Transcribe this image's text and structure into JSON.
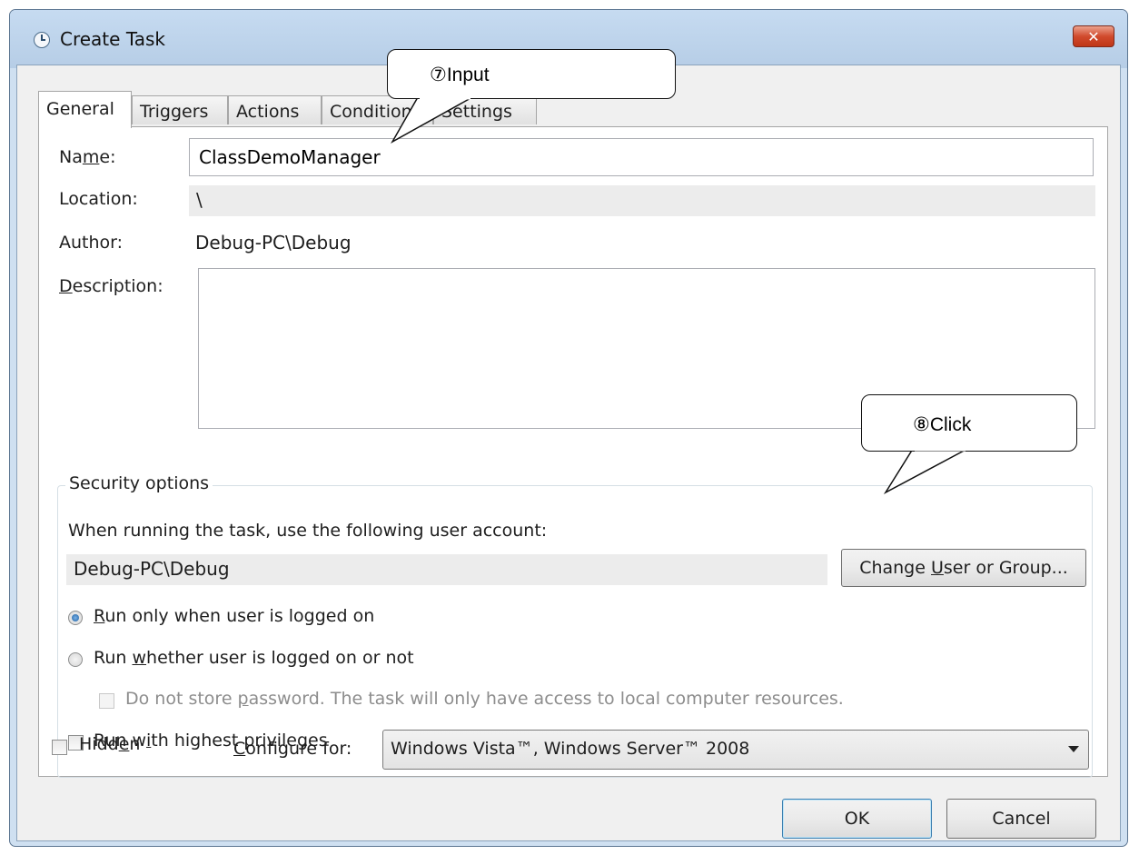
{
  "window": {
    "title": "Create Task",
    "close_glyph": "✕"
  },
  "tabs": [
    "General",
    "Triggers",
    "Actions",
    "Conditions",
    "Settings"
  ],
  "general": {
    "name_label_pre": "Na",
    "name_label_ul": "m",
    "name_label_post": "e:",
    "name_value": "ClassDemoManager",
    "location_label": "Location:",
    "location_value": "\\",
    "author_label": "Author:",
    "author_value": "Debug-PC\\Debug",
    "description_label_ul": "D",
    "description_label_post": "escription:",
    "description_value": ""
  },
  "security": {
    "group_title": "Security options",
    "account_prompt": "When running the task, use the following user account:",
    "account_value": "Debug-PC\\Debug",
    "change_button_pre": "Change ",
    "change_button_ul": "U",
    "change_button_post": "ser or Group...",
    "radio_logged_on": {
      "ul": "R",
      "post": "un only when user is logged on",
      "checked": true
    },
    "radio_whether": {
      "pre": "Run ",
      "ul": "w",
      "post": "hether user is logged on or not",
      "checked": false
    },
    "no_password": {
      "pre": "Do not store ",
      "ul": "p",
      "post": "assword.  The task will only have access to local computer resources.",
      "checked": false,
      "enabled": false
    },
    "highest_privileges": {
      "pre": "Run w",
      "ul": "i",
      "post": "th highest privileges",
      "checked": false
    }
  },
  "bottom": {
    "hidden": {
      "pre": "Hidd",
      "ul": "e",
      "post": "n",
      "checked": false
    },
    "configure_label_ul": "C",
    "configure_label_post": "onfigure for:",
    "configure_value": "Windows Vista™, Windows Server™ 2008"
  },
  "buttons": {
    "ok": "OK",
    "cancel": "Cancel"
  },
  "annotations": {
    "input_callout": "⑦Input",
    "click_callout": "⑧Click"
  }
}
